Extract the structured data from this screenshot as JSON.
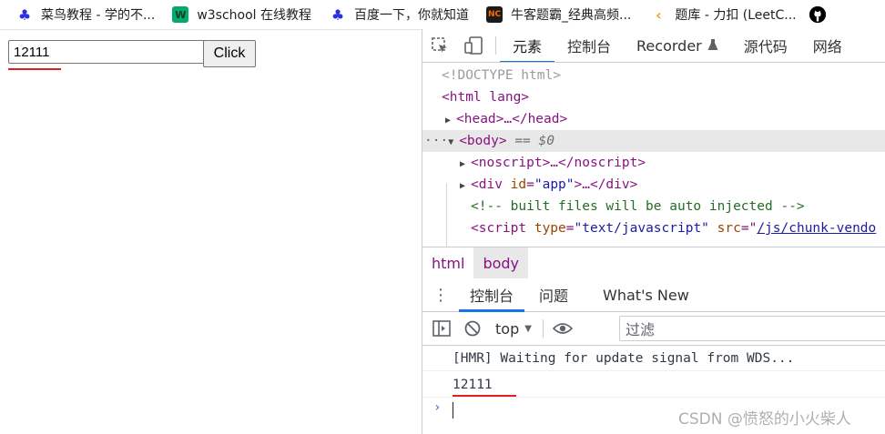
{
  "bookmarks": [
    {
      "label": "菜鸟教程 - 学的不...",
      "icon": "baidu-paw-icon"
    },
    {
      "label": "w3school 在线教程",
      "icon": "w3school-icon"
    },
    {
      "label": "百度一下，你就知道",
      "icon": "baidu-paw-icon"
    },
    {
      "label": "牛客题霸_经典高频...",
      "icon": "nowcoder-icon"
    },
    {
      "label": "题库 - 力扣 (LeetC...",
      "icon": "leetcode-icon"
    },
    {
      "label": "",
      "icon": "github-icon"
    }
  ],
  "page": {
    "input_value": "12111",
    "button_label": "Click"
  },
  "devtools": {
    "tabs": [
      "元素",
      "控制台",
      "Recorder",
      "源代码",
      "网络"
    ],
    "active_tab": "元素",
    "elements": {
      "doctype": "<!DOCTYPE html>",
      "html_open": "<html lang>",
      "head": "<head>…</head>",
      "body_tag": "<body>",
      "body_ref": "== $0",
      "noscript": "<noscript>…</noscript>",
      "div_app_prefix": "<div",
      "div_app_attr": "id",
      "div_app_val": "\"app\"",
      "div_app_suffix": ">…</div>",
      "comment": "<!-- built files will be auto injected -->",
      "script_tag": "<script",
      "script_type_attr": "type",
      "script_type_val": "\"text/javascript\"",
      "script_src_attr": "src",
      "script_src_val": "/js/chunk-vendo"
    },
    "breadcrumbs": [
      "html",
      "body"
    ],
    "drawer_tabs": [
      "控制台",
      "问题",
      "What's New"
    ],
    "context": "top",
    "filter_placeholder": "过滤",
    "console_messages": [
      "[HMR] Waiting for update signal from WDS...",
      "12111"
    ],
    "prompt_symbol": "›"
  },
  "watermark": "CSDN @愤怒的小火柴人",
  "colors": {
    "accent": "#1a73e8",
    "annotation_red": "#e02020",
    "tag": "#881280",
    "attr_name": "#994500",
    "attr_value": "#1a1aa6",
    "comment": "#236e25"
  }
}
